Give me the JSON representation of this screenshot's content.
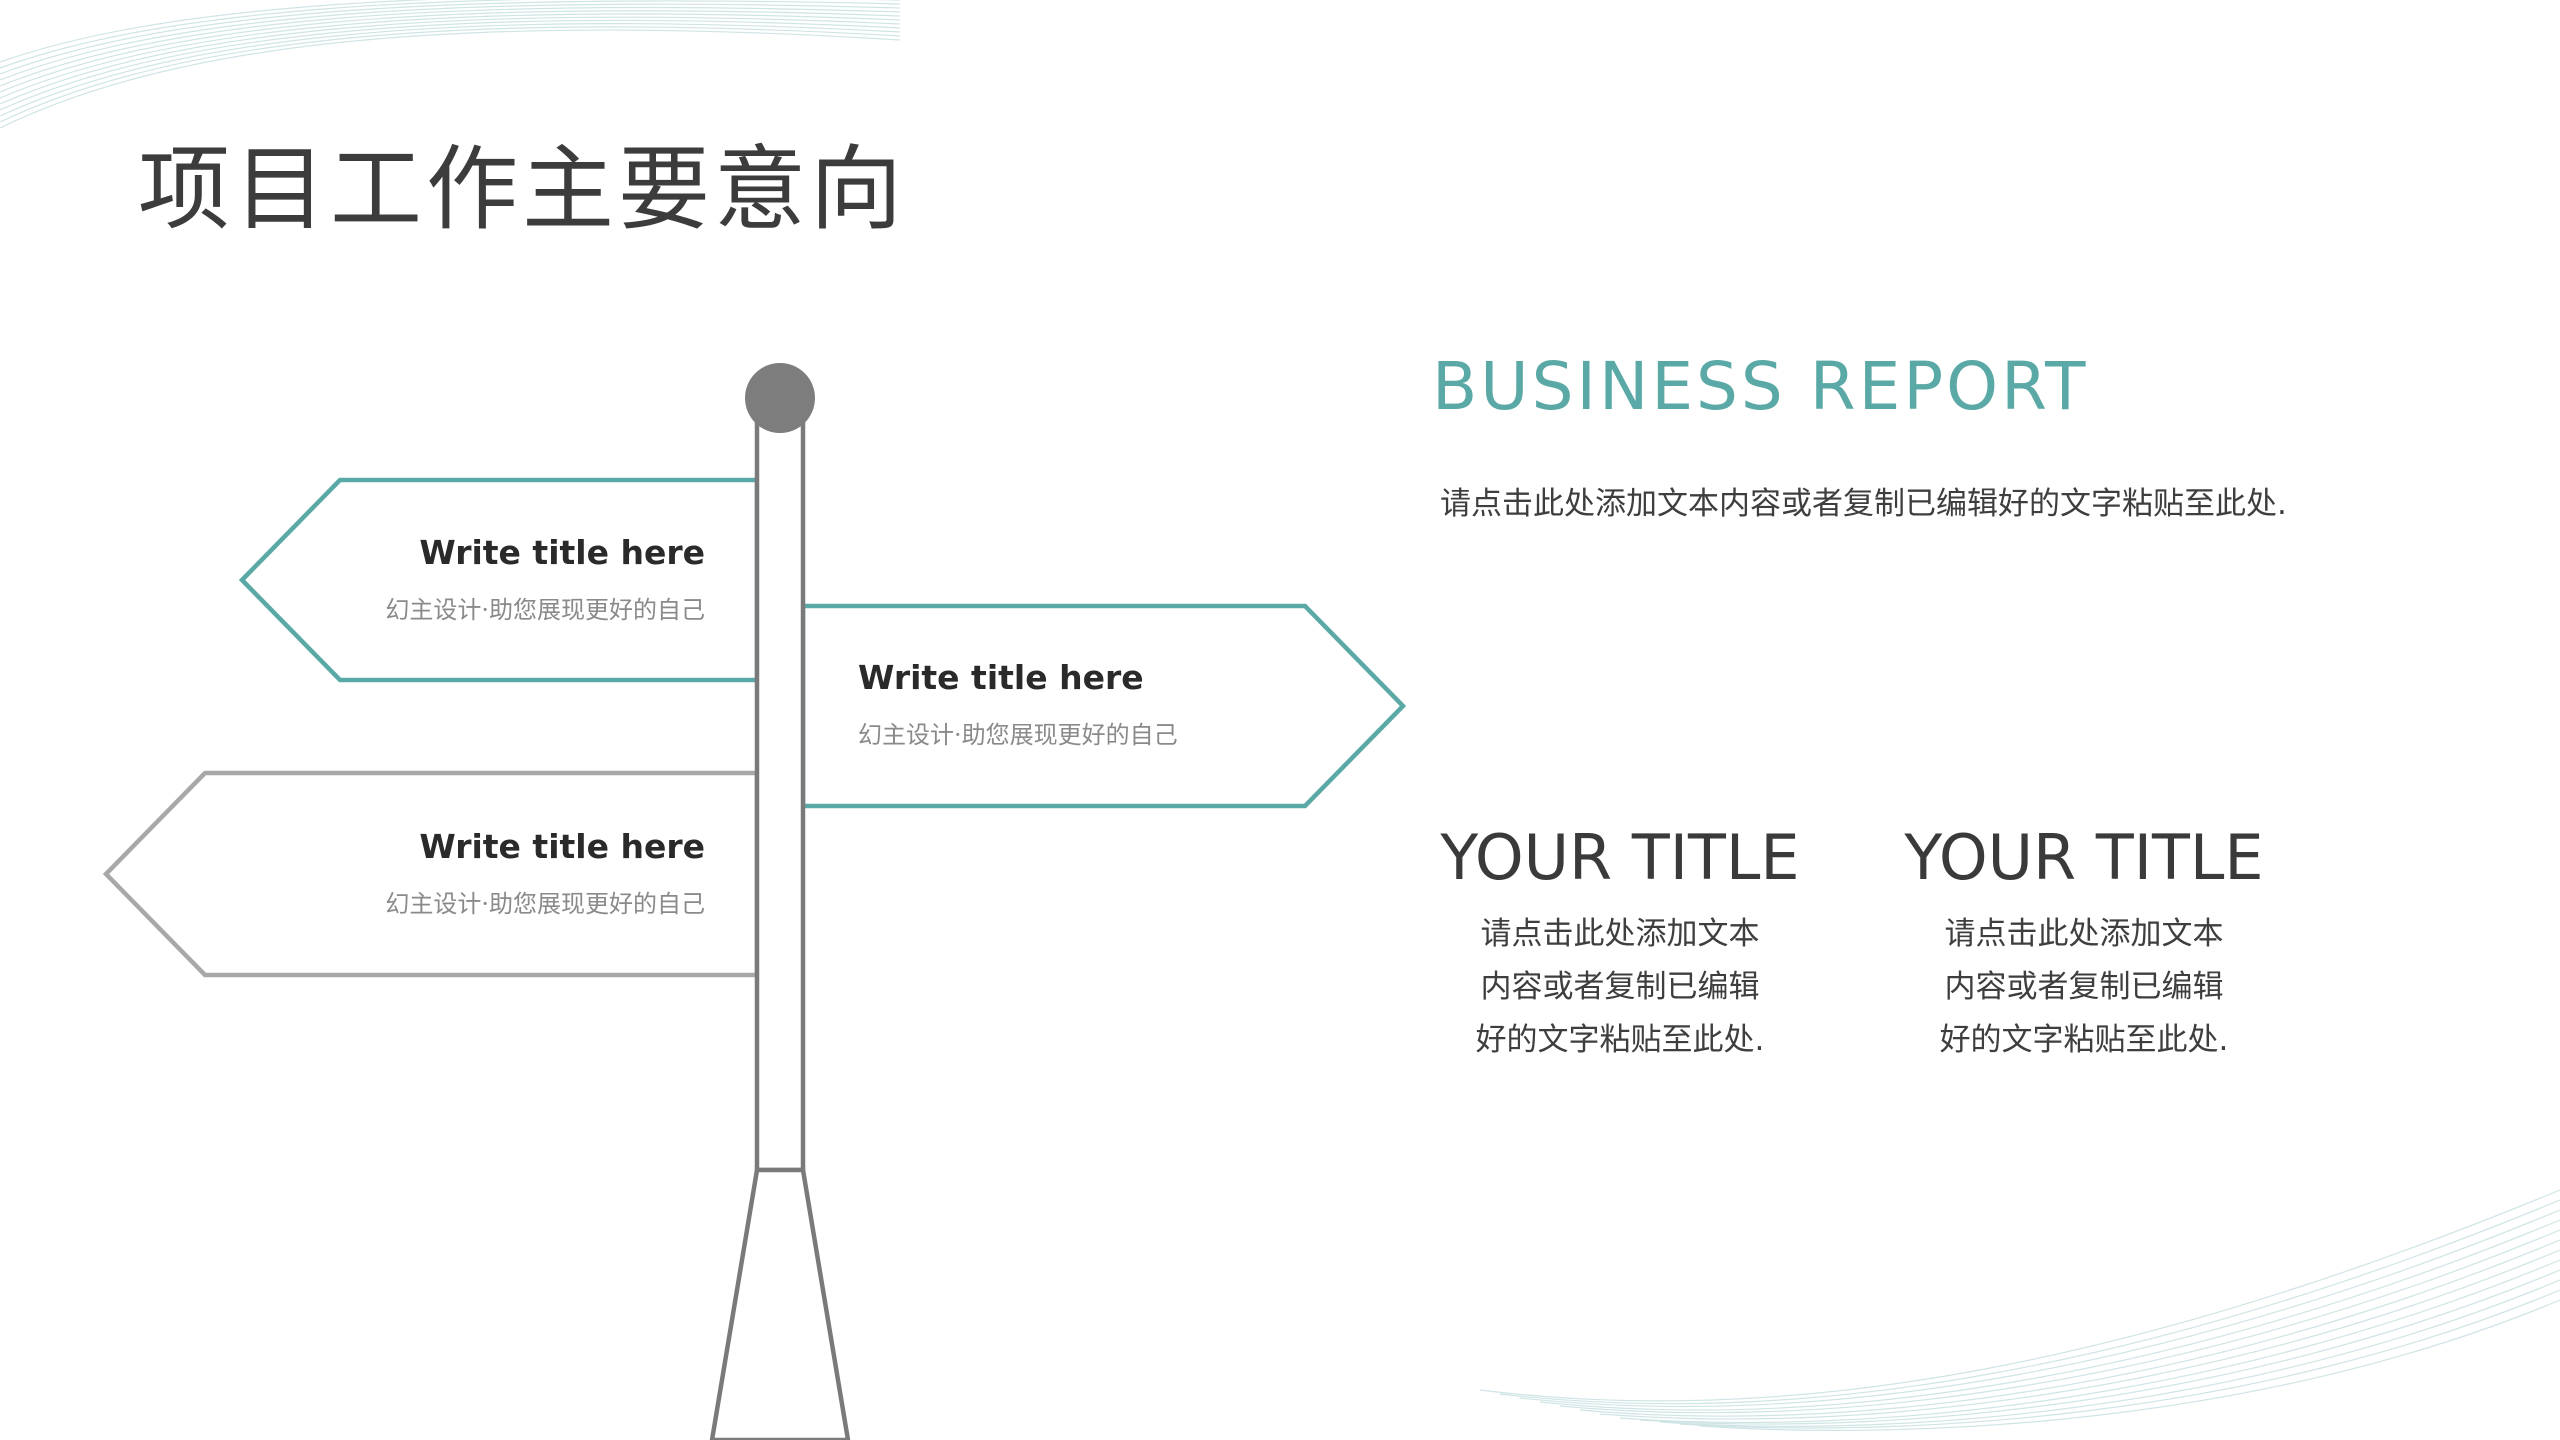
{
  "page_title": "项目工作主要意向",
  "signs": [
    {
      "title": "Write title here",
      "subtitle": "幻主设计·助您展现更好的自己"
    },
    {
      "title": "Write title here",
      "subtitle": "幻主设计·助您展现更好的自己"
    },
    {
      "title": "Write title here",
      "subtitle": "幻主设计·助您展现更好的自己"
    }
  ],
  "business": {
    "title": "BUSINESS REPORT",
    "body": "请点击此处添加文本内容或者复制已编辑好的文字粘贴至此处."
  },
  "columns": [
    {
      "title": "YOUR TITLE",
      "lines": [
        "请点击此处添加文本",
        "内容或者复制已编辑",
        "好的文字粘贴至此处."
      ]
    },
    {
      "title": "YOUR TITLE",
      "lines": [
        "请点击此处添加文本",
        "内容或者复制已编辑",
        "好的文字粘贴至此处."
      ]
    }
  ],
  "colors": {
    "accent": "#5aa9a6",
    "gray_outline": "#a8a8a8",
    "pole": "#7a7a7a",
    "knob": "#7d7d7d"
  }
}
